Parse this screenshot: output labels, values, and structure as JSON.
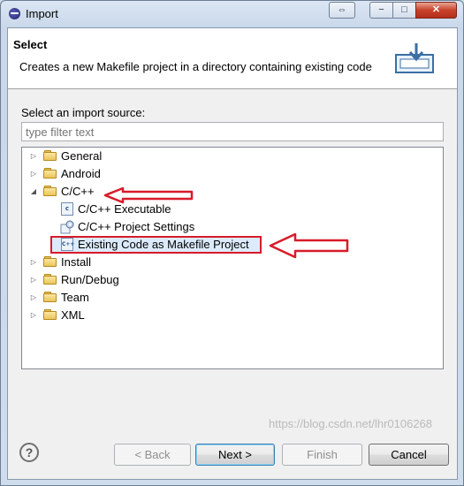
{
  "window": {
    "title": "Import",
    "restore_symbol": "⇔",
    "min_symbol": "−",
    "max_symbol": "□",
    "close_symbol": "✕"
  },
  "banner": {
    "title": "Select",
    "description": "Creates a new Makefile project in a directory containing existing code"
  },
  "source": {
    "label": "Select an import source:",
    "filter_placeholder": "type filter text"
  },
  "tree": {
    "items": [
      {
        "label": "General",
        "icon": "folder-icon",
        "arrow": "▷"
      },
      {
        "label": "Android",
        "icon": "folder-icon",
        "arrow": "▷"
      },
      {
        "label": "C/C++",
        "icon": "folder-open-icon",
        "arrow": "◢"
      },
      {
        "label": "C/C++ Executable",
        "icon": "c-executable-icon",
        "icon_text": "c"
      },
      {
        "label": "C/C++ Project Settings",
        "icon": "project-settings-icon"
      },
      {
        "label": "Existing Code as Makefile Project",
        "icon": "makefile-project-icon",
        "icon_text": "C++",
        "selected": true
      },
      {
        "label": "Install",
        "icon": "folder-icon",
        "arrow": "▷"
      },
      {
        "label": "Run/Debug",
        "icon": "folder-icon",
        "arrow": "▷"
      },
      {
        "label": "Team",
        "icon": "folder-icon",
        "arrow": "▷"
      },
      {
        "label": "XML",
        "icon": "folder-icon",
        "arrow": "▷"
      }
    ]
  },
  "buttons": {
    "help": "?",
    "back": "< Back",
    "next": "Next >",
    "finish": "Finish",
    "cancel": "Cancel"
  },
  "watermark": "https://blog.csdn.net/lhr0106268",
  "colors": {
    "annotation_red": "#d81b2a",
    "selection": "#dcebfc"
  }
}
